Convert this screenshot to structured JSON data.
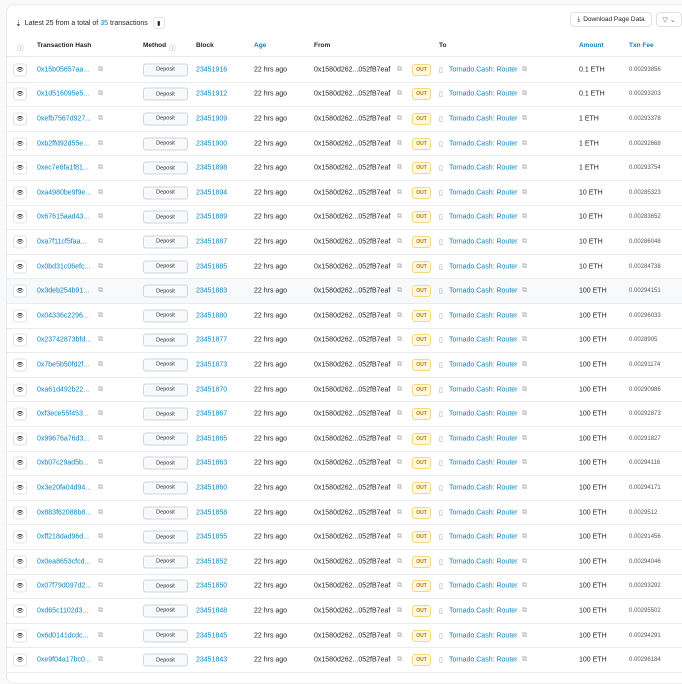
{
  "header": {
    "prefix": "Latest 25 from a total of",
    "total": "35",
    "suffix": "transactions",
    "download": "Download Page Data"
  },
  "columns": {
    "hash": "Transaction Hash",
    "method": "Method",
    "block": "Block",
    "age": "Age",
    "from": "From",
    "to": "To",
    "amount": "Amount",
    "fee": "Txn Fee"
  },
  "common": {
    "method": "Deposit",
    "age": "22 hrs ago",
    "from": "0x1580d262...052fB7eaf",
    "direction": "OUT",
    "to": "Tornado.Cash: Router"
  },
  "rows": [
    {
      "hash": "0x15b05657aa...",
      "block": "23451916",
      "amount": "0.1 ETH",
      "fee": "0.00293856"
    },
    {
      "hash": "0x1d516095e5...",
      "block": "23451912",
      "amount": "0.1 ETH",
      "fee": "0.00293203"
    },
    {
      "hash": "0xefb7567d927...",
      "block": "23451909",
      "amount": "1 ETH",
      "fee": "0.00293378"
    },
    {
      "hash": "0xb2ffd92d55e...",
      "block": "23451900",
      "amount": "1 ETH",
      "fee": "0.00292668"
    },
    {
      "hash": "0xec7e6fa1f81...",
      "block": "23451898",
      "amount": "1 ETH",
      "fee": "0.00293754"
    },
    {
      "hash": "0xa4980be9f9e...",
      "block": "23451894",
      "amount": "10 ETH",
      "fee": "0.00285323"
    },
    {
      "hash": "0x67615aad43...",
      "block": "23451889",
      "amount": "10 ETH",
      "fee": "0.00283652"
    },
    {
      "hash": "0xa7f11cf5faa...",
      "block": "23451887",
      "amount": "10 ETH",
      "fee": "0.00286048"
    },
    {
      "hash": "0x0bd31c06efc...",
      "block": "23451885",
      "amount": "10 ETH",
      "fee": "0.00284738"
    },
    {
      "hash": "0x3deb254b91...",
      "block": "23451883",
      "amount": "100 ETH",
      "fee": "0.00294151"
    },
    {
      "hash": "0x04336c2296...",
      "block": "23451880",
      "amount": "100 ETH",
      "fee": "0.00296033"
    },
    {
      "hash": "0x23742873bfd...",
      "block": "23451877",
      "amount": "100 ETH",
      "fee": "0.0028905"
    },
    {
      "hash": "0x7be5b50fd2f...",
      "block": "23451873",
      "amount": "100 ETH",
      "fee": "0.00291174"
    },
    {
      "hash": "0xa61d492b22...",
      "block": "23451870",
      "amount": "100 ETH",
      "fee": "0.00290986"
    },
    {
      "hash": "0xf3ece55f453...",
      "block": "23451867",
      "amount": "100 ETH",
      "fee": "0.00292873"
    },
    {
      "hash": "0x99676a76d3...",
      "block": "23451865",
      "amount": "100 ETH",
      "fee": "0.00291827"
    },
    {
      "hash": "0xb07c29ad5b...",
      "block": "23451863",
      "amount": "100 ETH",
      "fee": "0.00294116"
    },
    {
      "hash": "0x3e20fa04d94...",
      "block": "23451860",
      "amount": "100 ETH",
      "fee": "0.00294171"
    },
    {
      "hash": "0x883f62088b8...",
      "block": "23451858",
      "amount": "100 ETH",
      "fee": "0.0029512"
    },
    {
      "hash": "0xff218dad96d...",
      "block": "23451855",
      "amount": "100 ETH",
      "fee": "0.00291456"
    },
    {
      "hash": "0x0ea8653cfcd...",
      "block": "23451852",
      "amount": "100 ETH",
      "fee": "0.00294046"
    },
    {
      "hash": "0x07f79d097d2...",
      "block": "23451850",
      "amount": "100 ETH",
      "fee": "0.00293292"
    },
    {
      "hash": "0xd65c1102d3...",
      "block": "23451848",
      "amount": "100 ETH",
      "fee": "0.00295502"
    },
    {
      "hash": "0x6d0141dcdc...",
      "block": "23451845",
      "amount": "100 ETH",
      "fee": "0.00294291"
    },
    {
      "hash": "0xe9f04a17bc0...",
      "block": "23451843",
      "amount": "100 ETH",
      "fee": "0.00296184"
    }
  ],
  "colors": {
    "link": "#0784c3",
    "out_bg": "#fff8e1",
    "out_text": "#b47d00"
  }
}
